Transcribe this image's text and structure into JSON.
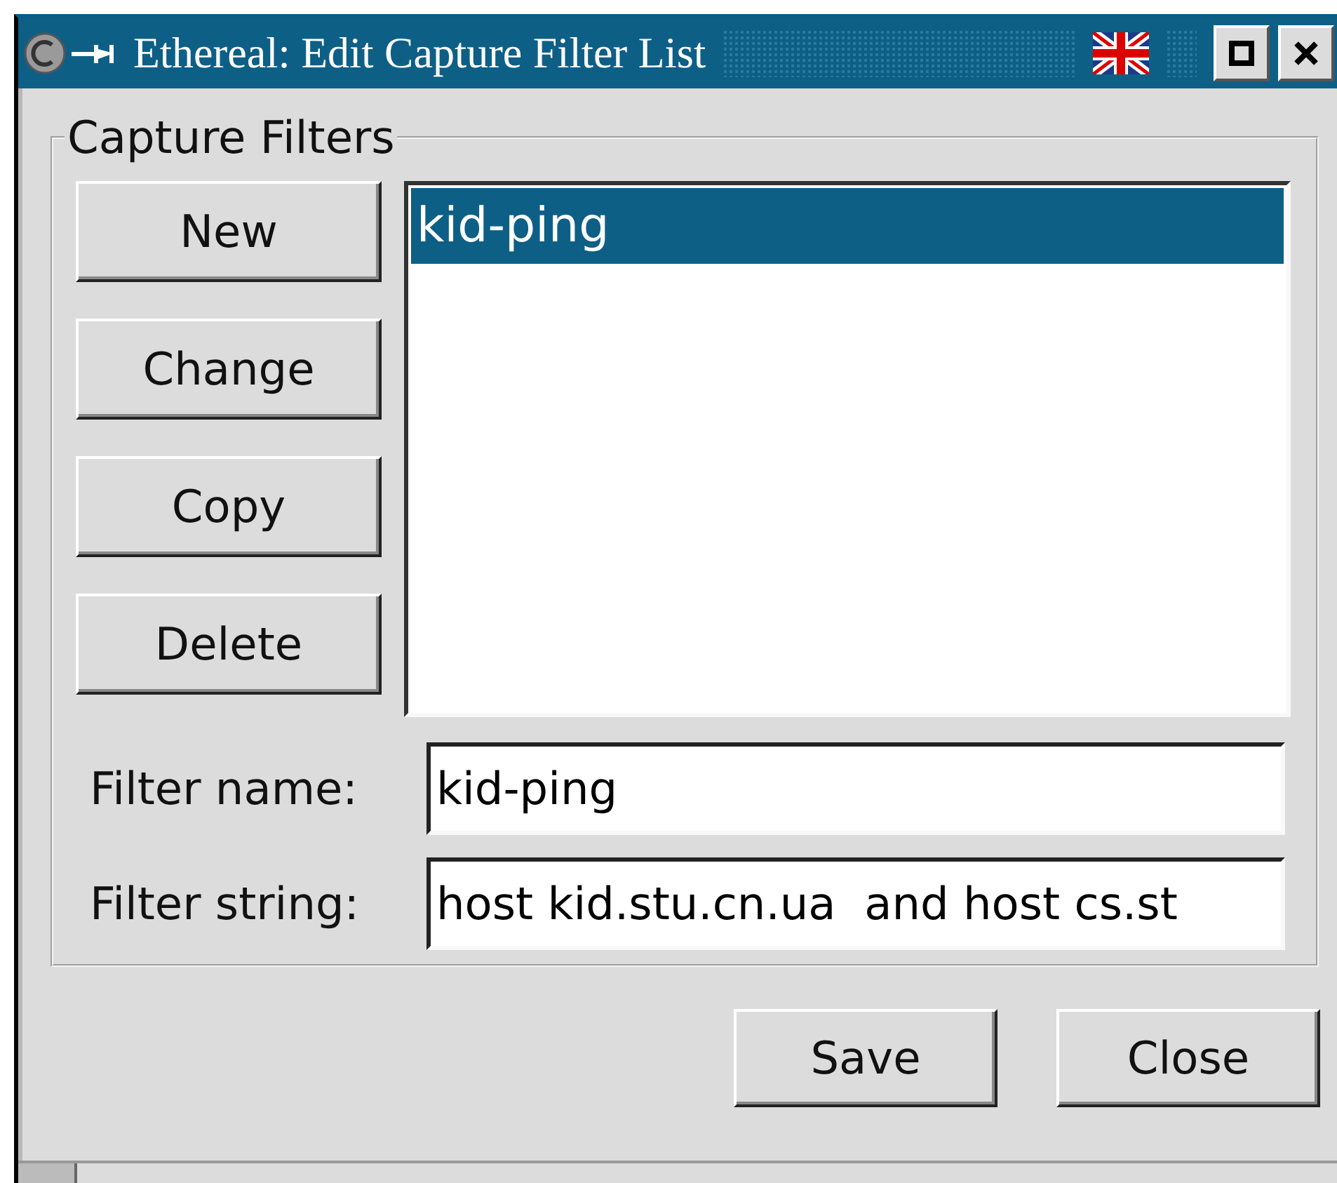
{
  "window": {
    "title": "Ethereal: Edit Capture Filter List"
  },
  "frame": {
    "title": "Capture Filters"
  },
  "buttons": [
    "New",
    "Change",
    "Copy",
    "Delete"
  ],
  "filters": [
    {
      "label": "kid-ping",
      "selected": true
    }
  ],
  "fields": [
    {
      "label": "Filter name:",
      "value": "kid-ping"
    },
    {
      "label": "Filter string:",
      "value": "host kid.stu.cn.ua  and host cs.st"
    }
  ],
  "actions": [
    "Save",
    "Close"
  ]
}
